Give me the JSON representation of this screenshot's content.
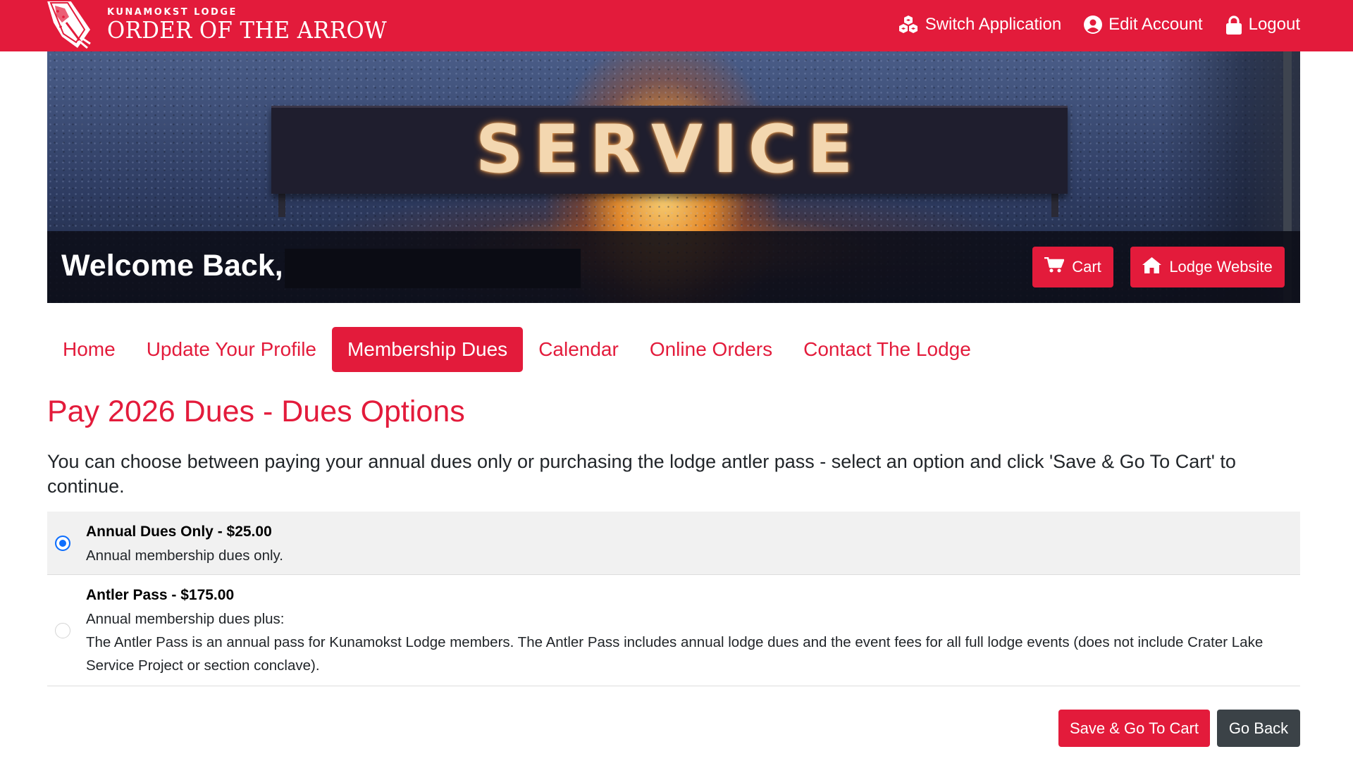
{
  "brand": {
    "lodge_name": "KUNAMOKST LODGE",
    "org_name": "ORDER OF THE ARROW",
    "logo_icon": "arrowhead-logo-icon"
  },
  "top_nav": {
    "switch_application": "Switch Application",
    "edit_account": "Edit Account",
    "logout": "Logout",
    "icons": [
      "cubes-icon",
      "user-circle-icon",
      "lock-icon"
    ]
  },
  "hero": {
    "sign_text": "SERVICE",
    "welcome_text": "Welcome Back,",
    "cart_label": "Cart",
    "lodge_website_label": "Lodge Website"
  },
  "tabs": [
    {
      "label": "Home",
      "active": false
    },
    {
      "label": "Update Your Profile",
      "active": false
    },
    {
      "label": "Membership Dues",
      "active": true
    },
    {
      "label": "Calendar",
      "active": false
    },
    {
      "label": "Online Orders",
      "active": false
    },
    {
      "label": "Contact The Lodge",
      "active": false
    }
  ],
  "page": {
    "title": "Pay 2026 Dues - Dues Options",
    "intro": "You can choose between paying your annual dues only or purchasing the lodge antler pass - select an option and click 'Save & Go To Cart' to continue."
  },
  "options": [
    {
      "title": "Annual Dues Only - $25.00",
      "line1": "Annual membership dues only.",
      "selected": true
    },
    {
      "title": "Antler Pass - $175.00",
      "line1": "Annual membership dues plus:",
      "detail": "The Antler Pass is an annual pass for Kunamokst Lodge members. The Antler Pass includes annual lodge dues and the event fees for all full lodge events (does not include Crater Lake Service Project or section conclave).",
      "selected": false
    }
  ],
  "actions": {
    "save_label": "Save & Go To Cart",
    "back_label": "Go Back"
  },
  "colors": {
    "brand_red": "#e31b3b",
    "dark_button": "#3b4247",
    "radio_blue": "#0d6efd"
  }
}
